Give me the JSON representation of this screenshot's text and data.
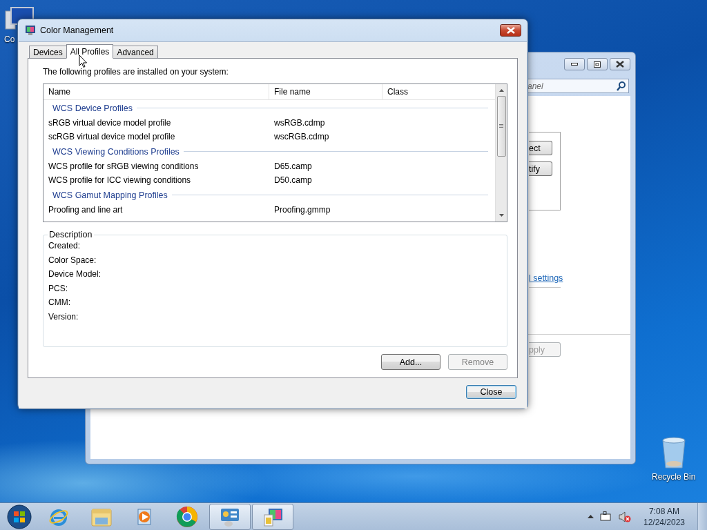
{
  "desktop": {
    "icons": [
      {
        "kind": "computer",
        "label": "Co"
      },
      {
        "kind": "recycle",
        "label": "Recycle Bin"
      }
    ]
  },
  "background_window": {
    "search": {
      "placeholder": "anel"
    },
    "buttons": [
      {
        "label": "ect"
      },
      {
        "label": "tify"
      }
    ],
    "link": "l settings",
    "apply_button": {
      "label": "pply",
      "disabled": true
    }
  },
  "dialog": {
    "title": "Color Management",
    "tabs": [
      {
        "label": "Devices",
        "selected": false
      },
      {
        "label": "All Profiles",
        "selected": true
      },
      {
        "label": "Advanced",
        "selected": false
      }
    ],
    "intro": "The following profiles are installed on your system:",
    "list": {
      "columns": [
        "Name",
        "File name",
        "Class"
      ],
      "groups": [
        {
          "title": "WCS Device Profiles",
          "rows": [
            {
              "name": "sRGB virtual device model profile",
              "file": "wsRGB.cdmp"
            },
            {
              "name": "scRGB virtual device model profile",
              "file": "wscRGB.cdmp"
            }
          ]
        },
        {
          "title": "WCS Viewing Conditions Profiles",
          "rows": [
            {
              "name": "WCS profile for sRGB viewing conditions",
              "file": "D65.camp"
            },
            {
              "name": "WCS profile for ICC viewing conditions",
              "file": "D50.camp"
            }
          ]
        },
        {
          "title": "WCS Gamut Mapping Profiles",
          "rows": [
            {
              "name": "Proofing and line art",
              "file": "Proofing.gmmp"
            }
          ]
        }
      ]
    },
    "description": {
      "title": "Description",
      "fields": [
        "Created:",
        "Color Space:",
        "Device Model:",
        "PCS:",
        "CMM:",
        "Version:"
      ]
    },
    "buttons": [
      {
        "label": "Add...",
        "disabled": false
      },
      {
        "label": "Remove",
        "disabled": true
      }
    ],
    "close_button": {
      "label": "Close"
    }
  },
  "taskbar": {
    "apps": [
      {
        "kind": "ie",
        "active": false
      },
      {
        "kind": "explorer",
        "active": false
      },
      {
        "kind": "media",
        "active": false
      },
      {
        "kind": "chrome",
        "active": false
      },
      {
        "kind": "control",
        "active": true
      },
      {
        "kind": "color",
        "active": true
      }
    ],
    "clock": {
      "time": "7:08 AM",
      "date": "12/24/2023"
    }
  }
}
